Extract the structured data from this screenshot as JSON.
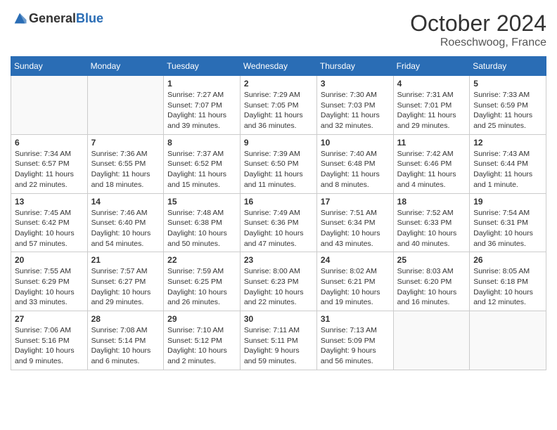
{
  "header": {
    "logo_general": "General",
    "logo_blue": "Blue",
    "month_year": "October 2024",
    "location": "Roeschwoog, France"
  },
  "days_of_week": [
    "Sunday",
    "Monday",
    "Tuesday",
    "Wednesday",
    "Thursday",
    "Friday",
    "Saturday"
  ],
  "weeks": [
    [
      {
        "day": "",
        "info": ""
      },
      {
        "day": "",
        "info": ""
      },
      {
        "day": "1",
        "info": "Sunrise: 7:27 AM\nSunset: 7:07 PM\nDaylight: 11 hours and 39 minutes."
      },
      {
        "day": "2",
        "info": "Sunrise: 7:29 AM\nSunset: 7:05 PM\nDaylight: 11 hours and 36 minutes."
      },
      {
        "day": "3",
        "info": "Sunrise: 7:30 AM\nSunset: 7:03 PM\nDaylight: 11 hours and 32 minutes."
      },
      {
        "day": "4",
        "info": "Sunrise: 7:31 AM\nSunset: 7:01 PM\nDaylight: 11 hours and 29 minutes."
      },
      {
        "day": "5",
        "info": "Sunrise: 7:33 AM\nSunset: 6:59 PM\nDaylight: 11 hours and 25 minutes."
      }
    ],
    [
      {
        "day": "6",
        "info": "Sunrise: 7:34 AM\nSunset: 6:57 PM\nDaylight: 11 hours and 22 minutes."
      },
      {
        "day": "7",
        "info": "Sunrise: 7:36 AM\nSunset: 6:55 PM\nDaylight: 11 hours and 18 minutes."
      },
      {
        "day": "8",
        "info": "Sunrise: 7:37 AM\nSunset: 6:52 PM\nDaylight: 11 hours and 15 minutes."
      },
      {
        "day": "9",
        "info": "Sunrise: 7:39 AM\nSunset: 6:50 PM\nDaylight: 11 hours and 11 minutes."
      },
      {
        "day": "10",
        "info": "Sunrise: 7:40 AM\nSunset: 6:48 PM\nDaylight: 11 hours and 8 minutes."
      },
      {
        "day": "11",
        "info": "Sunrise: 7:42 AM\nSunset: 6:46 PM\nDaylight: 11 hours and 4 minutes."
      },
      {
        "day": "12",
        "info": "Sunrise: 7:43 AM\nSunset: 6:44 PM\nDaylight: 11 hours and 1 minute."
      }
    ],
    [
      {
        "day": "13",
        "info": "Sunrise: 7:45 AM\nSunset: 6:42 PM\nDaylight: 10 hours and 57 minutes."
      },
      {
        "day": "14",
        "info": "Sunrise: 7:46 AM\nSunset: 6:40 PM\nDaylight: 10 hours and 54 minutes."
      },
      {
        "day": "15",
        "info": "Sunrise: 7:48 AM\nSunset: 6:38 PM\nDaylight: 10 hours and 50 minutes."
      },
      {
        "day": "16",
        "info": "Sunrise: 7:49 AM\nSunset: 6:36 PM\nDaylight: 10 hours and 47 minutes."
      },
      {
        "day": "17",
        "info": "Sunrise: 7:51 AM\nSunset: 6:34 PM\nDaylight: 10 hours and 43 minutes."
      },
      {
        "day": "18",
        "info": "Sunrise: 7:52 AM\nSunset: 6:33 PM\nDaylight: 10 hours and 40 minutes."
      },
      {
        "day": "19",
        "info": "Sunrise: 7:54 AM\nSunset: 6:31 PM\nDaylight: 10 hours and 36 minutes."
      }
    ],
    [
      {
        "day": "20",
        "info": "Sunrise: 7:55 AM\nSunset: 6:29 PM\nDaylight: 10 hours and 33 minutes."
      },
      {
        "day": "21",
        "info": "Sunrise: 7:57 AM\nSunset: 6:27 PM\nDaylight: 10 hours and 29 minutes."
      },
      {
        "day": "22",
        "info": "Sunrise: 7:59 AM\nSunset: 6:25 PM\nDaylight: 10 hours and 26 minutes."
      },
      {
        "day": "23",
        "info": "Sunrise: 8:00 AM\nSunset: 6:23 PM\nDaylight: 10 hours and 22 minutes."
      },
      {
        "day": "24",
        "info": "Sunrise: 8:02 AM\nSunset: 6:21 PM\nDaylight: 10 hours and 19 minutes."
      },
      {
        "day": "25",
        "info": "Sunrise: 8:03 AM\nSunset: 6:20 PM\nDaylight: 10 hours and 16 minutes."
      },
      {
        "day": "26",
        "info": "Sunrise: 8:05 AM\nSunset: 6:18 PM\nDaylight: 10 hours and 12 minutes."
      }
    ],
    [
      {
        "day": "27",
        "info": "Sunrise: 7:06 AM\nSunset: 5:16 PM\nDaylight: 10 hours and 9 minutes."
      },
      {
        "day": "28",
        "info": "Sunrise: 7:08 AM\nSunset: 5:14 PM\nDaylight: 10 hours and 6 minutes."
      },
      {
        "day": "29",
        "info": "Sunrise: 7:10 AM\nSunset: 5:12 PM\nDaylight: 10 hours and 2 minutes."
      },
      {
        "day": "30",
        "info": "Sunrise: 7:11 AM\nSunset: 5:11 PM\nDaylight: 9 hours and 59 minutes."
      },
      {
        "day": "31",
        "info": "Sunrise: 7:13 AM\nSunset: 5:09 PM\nDaylight: 9 hours and 56 minutes."
      },
      {
        "day": "",
        "info": ""
      },
      {
        "day": "",
        "info": ""
      }
    ]
  ]
}
